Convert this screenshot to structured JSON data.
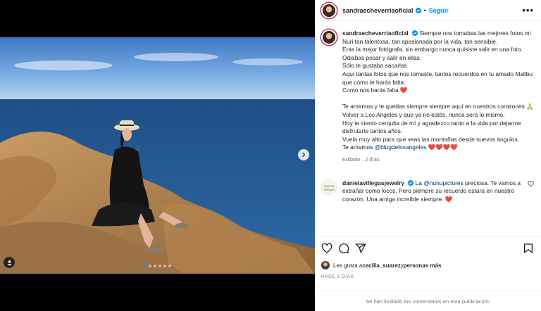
{
  "post": {
    "username": "sandraecheverriaoficial",
    "separator": "•",
    "follow_label": "Seguir",
    "more_label": "•••",
    "verified_icon": "verified-badge-icon"
  },
  "media": {
    "carousel_dots": 6,
    "active_dot": 0,
    "next_icon": "chevron-right-icon",
    "tag_icon": "user-tag-icon"
  },
  "caption": {
    "username": "sandraecheverriaoficial",
    "paragraph1": [
      "Siempre nos tomabas las mejores fotos mi Nuri tan talentosa, tan apasionada por la vida, tan sensible.",
      "Eras la mejor fotógrafa, sin embargo nunca quisiste salir en una foto.",
      "Odiabas posar y salir en ellas.",
      "Sólo te gustaba sacarlas.",
      "Aquí tantas fotos que nos tomaste, tantos recuerdos en tu amado Malibu que cómo le harás falta.",
      "Como nos harás falta ❤️"
    ],
    "paragraph2": [
      "Te amamos y te quedas siempre siempre aquí en nuestros corazones 🙏",
      "Volver a Los Angeles y que ya no estés, nunca será lo mismo.",
      "Hoy te siento cerquita de mí y agradezco tanto a la vida por dejarme disfrutarte tantos años.",
      "Vuela muy alto para que veas las montañas desde nuevos ángulos."
    ],
    "last_line_prefix": "Te amamos ",
    "mention": "@blogdelosangeles",
    "last_line_suffix": " ❤️❤️❤️❤️",
    "meta": "Editado · 2 días"
  },
  "comment": {
    "username": "danielavillegasjewelry",
    "avatar_text": "daniela villegas",
    "mention": "@nunupictures",
    "text_before": " La ",
    "text_after": " preciosa. Te vamos a extrañar como locos. Pero siempre su recuerdo estara en nuestro corazón. Una amiga increíble siempre. ❤️",
    "like_icon": "heart-outline-icon"
  },
  "actions": {
    "icons": [
      "heart-outline-icon",
      "comment-icon",
      "share-icon",
      "bookmark-icon"
    ]
  },
  "likes": {
    "prefix": "Les gusta a ",
    "user": "cecilia_suarez",
    "middle": " y ",
    "others": "personas más"
  },
  "date": "HACE 3 DÍAS",
  "footer": "Se han limitado los comentarios en esta publicación.",
  "colors": {
    "accent": "#0095f6",
    "heart": "#e0245e",
    "ring": "#d62976"
  }
}
